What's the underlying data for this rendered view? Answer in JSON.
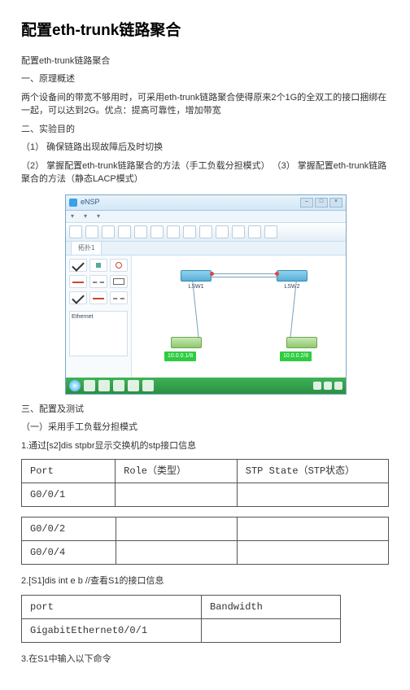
{
  "title": "配置eth-trunk链路聚合",
  "intro_line": "配置eth-trunk链路聚合",
  "section1_heading": "一、原理概述",
  "section1_body": "两个设备间的带宽不够用时，可采用eth-trunk链路聚合使得原来2个1G的全双工的接口捆绑在一起，可以达到2G。优点：提高可靠性，增加带宽",
  "section2_heading": "二、实验目的",
  "section2_item1": "（1） 确保链路出现故障后及时切换",
  "section2_item2": "（2） 掌握配置eth-trunk链路聚合的方法（手工负载分担模式） （3） 掌握配置eth-trunk链路聚合的方法（静态LACP模式）",
  "app_title": "eNSP",
  "tab1": "拓扑1",
  "palette_label": "Ethernet",
  "device_s1": "LSW1",
  "device_s2": "LSW2",
  "device_r1": " ",
  "device_r2": " ",
  "ip1": "10.0.0.1/8",
  "ip2": "10.0.0.2/8",
  "section3_heading": "三、配置及测试",
  "section3_sub1": "（一）采用手工负载分担模式",
  "step1": "1.通过[s2]dis stpbr显示交换机的stp接口信息",
  "table1": {
    "h1": "Port",
    "h2": "Role（类型）",
    "h3": "STP State（STP状态）",
    "r1c1": "G0/0/1"
  },
  "table2": {
    "r1c1": "G0/0/2",
    "r2c1": "G0/0/4"
  },
  "step2": "2.[S1]dis int e b //查看S1的接口信息",
  "table3": {
    "h1": "port",
    "h2": "Bandwidth",
    "r1c1": "GigabitEthernet0/0/1"
  },
  "step3": "3.在S1中输入以下命令"
}
